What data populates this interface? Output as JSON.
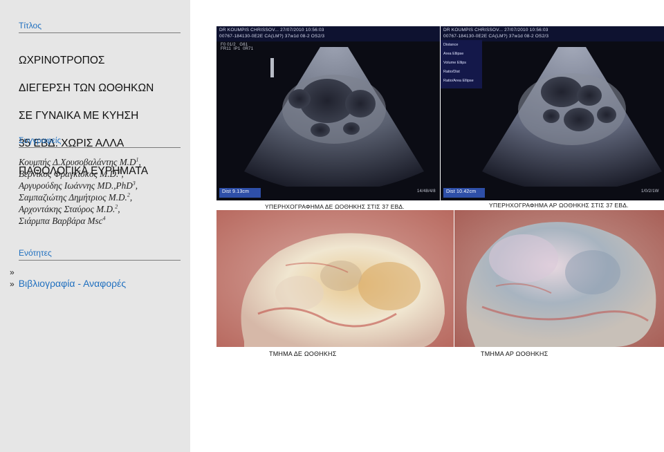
{
  "sidebar": {
    "title_label": "Τίτλος",
    "title_lines": [
      "ΩΧΡΙΝΟΤΡΟΠΟΣ",
      "ΔΙΕΓΕΡΣΗ ΤΩΝ ΩΟΘΗΚΩΝ",
      "ΣΕ ΓΥΝΑΙΚΑ ΜΕ ΚΥΗΣΗ",
      "35 ΕΒΔ. ΧΩΡΙΣ ΑΛΛΑ",
      "ΠΑΘΟΛΟΓΙΚΑ ΕΥΡΗΜΑΤΑ"
    ],
    "authors_label": "Συγγραφείς",
    "authors": [
      {
        "name": "Κουμπής Δ.Χρυσοβαλάντης M.D",
        "sup": "1",
        "sep": ","
      },
      {
        "name": "Βερνίκος Φραγκίσκος M.D.",
        "sup": "1",
        "sep": ","
      },
      {
        "name": "Αργυρούδης Ιωάννης MD.,PhD",
        "sup": "3",
        "sep": ","
      },
      {
        "name": "Σαμπαζιώτης Δημήτριος M.D.",
        "sup": "2",
        "sep": ","
      },
      {
        "name": "Αρχοντάκης Σταύρος M.D.",
        "sup": "2",
        "sep": ","
      },
      {
        "name": "Σιάρμπα Βαρβάρα Msc",
        "sup": "4",
        "sep": ""
      }
    ],
    "sections_label": "Ενότητες",
    "sections": [
      {
        "chev": "»",
        "label": ""
      },
      {
        "chev": "»",
        "label": "Βιβλιογραφία - Αναφορές"
      }
    ]
  },
  "figure": {
    "us_left": {
      "header": "DR KOUMPIS CHRISSOV...  27/07/2010  10:56:03",
      "header2": "00767-184130-0E2E CA(LM?) 37w1d      08-2      OS2/3",
      "side_text": "F0 01/2   G61\nFR11  IP1  0R71",
      "dist_label": "Dist  9.13cm",
      "scale": "14/48/4/8",
      "caption": "ΥΠΕΡΗΧΟΓΡΑΦΗΜΑ ΔΕ ΩΟΘΗΚΗΣ ΣΤΙΣ 37 ΕΒΔ."
    },
    "us_right": {
      "header": "DR KOUMPIS CHRISSOV...  27/07/2010  10:56:03",
      "header2": "00767-184130-0E2E CA(LM?) 37w1d      08-2      OS2/3",
      "menu": [
        {
          "label": "Distance",
          "value": ""
        },
        {
          "label": "Area",
          "value": "Ellipse"
        },
        {
          "label": "Volume",
          "value": "Ellips"
        },
        {
          "label": "Ratio/Dist",
          "value": ""
        },
        {
          "label": "Ratio/Area",
          "value": "Ellipse"
        }
      ],
      "dist_label": "Dist  10.42cm",
      "scale": "1/0/2/1W",
      "caption": "ΥΠΕΡΗΧΟΓΡΑΦΗΜΑ ΑΡ ΩΟΘΗΚΗΣ ΣΤΙΣ 37 ΕΒΔ."
    },
    "photo_left_caption": "ΤΜΗΜΑ ΔΕ ΩΟΘΗΚΗΣ",
    "photo_right_caption": "ΤΜΗΜΑ  ΑΡ ΩΟΘΗΚΗΣ"
  },
  "colors": {
    "accent": "#1f6fbf",
    "sidebar_bg": "#e6e6e6",
    "us_bg": "#0b0c14"
  }
}
